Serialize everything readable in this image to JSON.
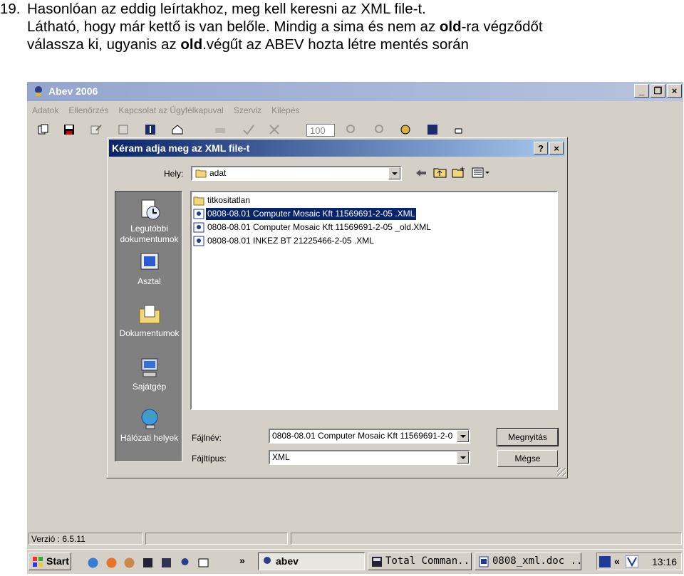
{
  "instruction": {
    "number": "19.",
    "line1": "Hasonlóan az eddig leírtakhoz, meg kell keresni az XML file-t.",
    "line2_before": "Látható, hogy már kettő is van belőle. Mindig a sima és nem az ",
    "line2_bold": "old",
    "line2_after": "-ra végződőt",
    "line3_before": "válassza ki, ugyanis az ",
    "line3_bold": "old",
    "line3_after": ".végűt az ABEV hozta létre mentés során"
  },
  "app": {
    "title": "Abev 2006",
    "menu": [
      "Adatok",
      "Ellenőrzés",
      "Kapcsolat az Ügyfélkapuval",
      "Szerviz",
      "Kilépés"
    ],
    "zoom": "100",
    "version": "Verzió : 6.5.11"
  },
  "dialog": {
    "title": "Kéram adja meg az XML file-t",
    "help": "?",
    "close": "×",
    "location_label": "Hely:",
    "location_value": "adat",
    "places": [
      "Legutóbbi dokumentumok",
      "Asztal",
      "Dokumentumok",
      "Sajátgép",
      "Hálózati helyek"
    ],
    "files": [
      {
        "name": "titkositatlan",
        "type": "folder"
      },
      {
        "name": "0808-08.01 Computer Mosaic Kft 11569691-2-05 .XML",
        "type": "xml",
        "selected": true
      },
      {
        "name": "0808-08.01 Computer Mosaic Kft 11569691-2-05 _old.XML",
        "type": "xml"
      },
      {
        "name": "0808-08.01 INKEZ BT 21225466-2-05 .XML",
        "type": "xml"
      }
    ],
    "filename_label": "Fájlnév:",
    "filename_value": "0808-08.01 Computer Mosaic Kft 11569691-2-0",
    "filetype_label": "Fájltípus:",
    "filetype_value": "XML",
    "open_button": "Megnyitás",
    "cancel_button": "Mégse"
  },
  "taskbar": {
    "start": "Start",
    "more": "»",
    "tasks": [
      "abev",
      "Total Comman...",
      "0808_xml.doc ..."
    ],
    "tray_more": "«",
    "clock": "13:16"
  },
  "colors": {
    "app_title_gradient": [
      "#94a6ce",
      "#b7c3de"
    ],
    "dialog_title_gradient": [
      "#0a246a",
      "#a6caf0"
    ],
    "selection": "#0a246a",
    "face": "#d4d0c8"
  }
}
